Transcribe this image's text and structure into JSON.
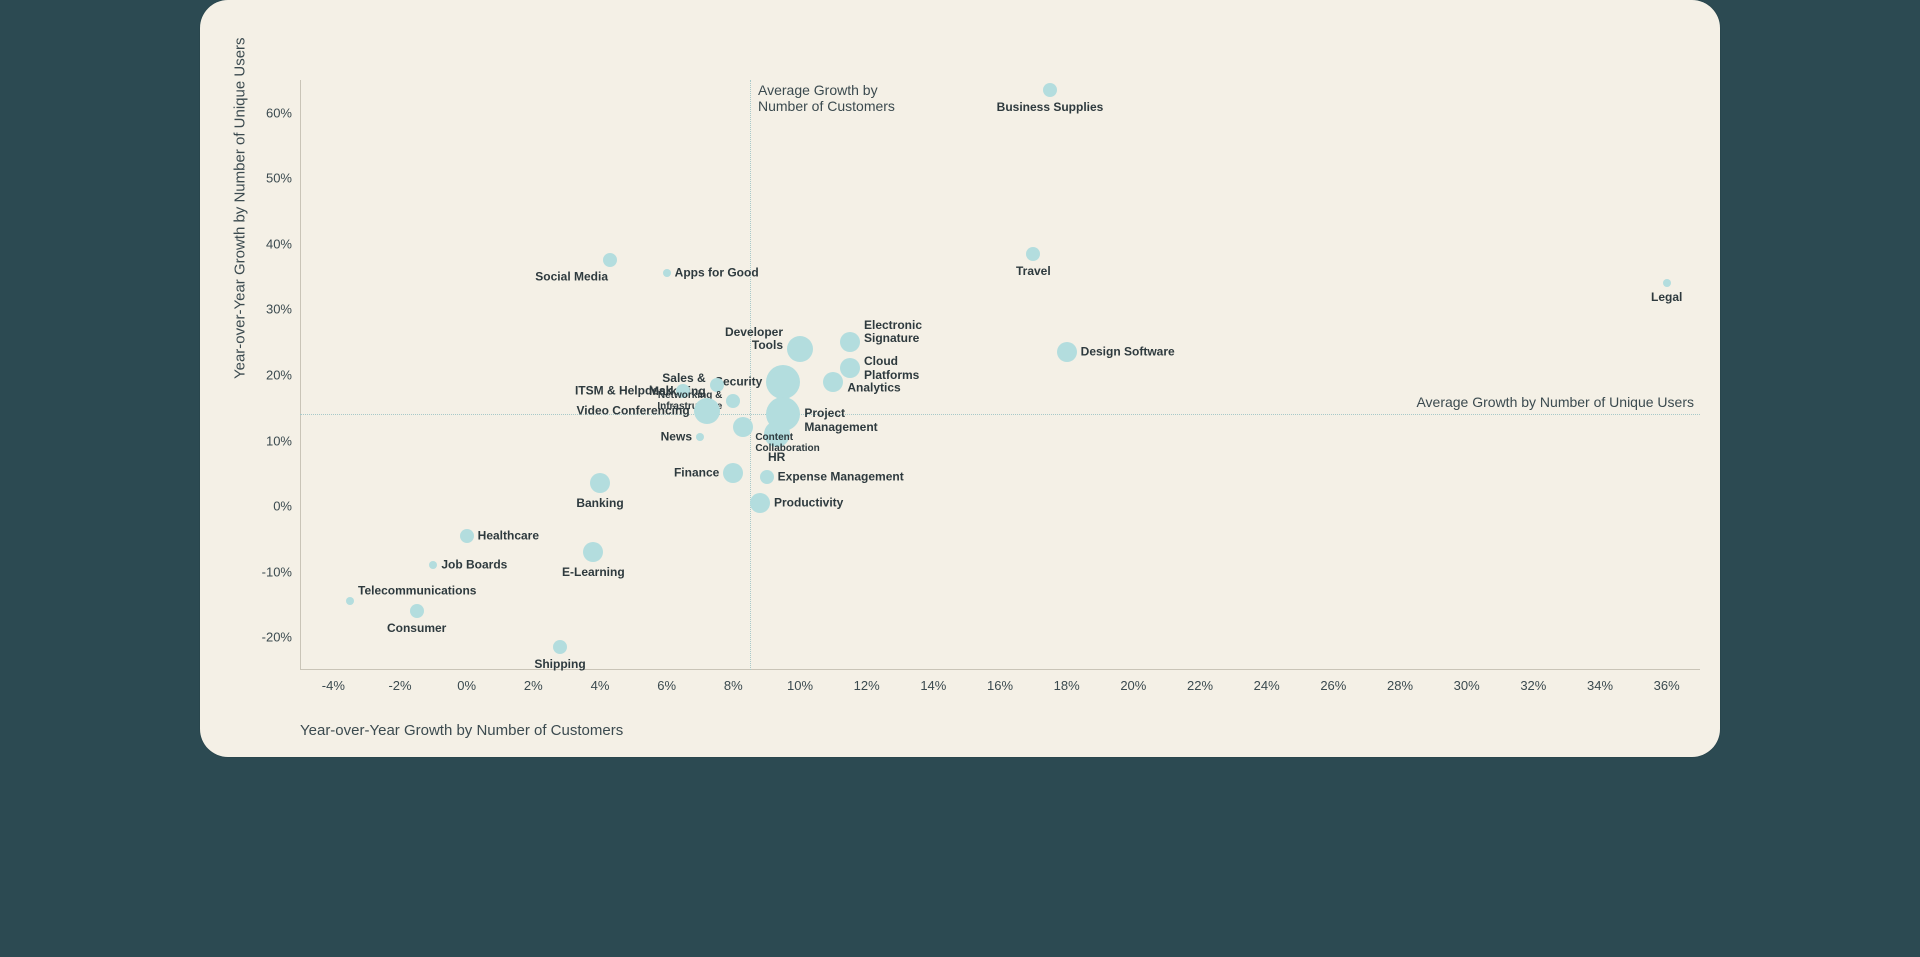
{
  "chart_data": {
    "type": "scatter",
    "title": "",
    "xlabel": "Year-over-Year Growth by Number of Customers",
    "ylabel": "Year-over-Year Growth by Number of Unique Users",
    "xlim": [
      -5,
      37
    ],
    "ylim": [
      -25,
      65
    ],
    "xticks": [
      -4,
      -2,
      0,
      2,
      4,
      6,
      8,
      10,
      12,
      14,
      16,
      18,
      20,
      22,
      24,
      26,
      28,
      30,
      32,
      34,
      36
    ],
    "yticks": [
      -20,
      -10,
      0,
      10,
      20,
      30,
      40,
      50,
      60
    ],
    "reference_lines": {
      "vertical": {
        "x": 8.5,
        "label": "Average Growth by\nNumber of Customers"
      },
      "horizontal": {
        "y": 14,
        "label": "Average Growth by Number of Unique Users"
      }
    },
    "series": [
      {
        "name": "Business Supplies",
        "x": 17.5,
        "y": 63.5,
        "size": 2,
        "label_pos": "below"
      },
      {
        "name": "Travel",
        "x": 17.0,
        "y": 38.5,
        "size": 2,
        "label_pos": "below"
      },
      {
        "name": "Social Media",
        "x": 4.3,
        "y": 37.5,
        "size": 2,
        "label_pos": "below-left"
      },
      {
        "name": "Apps for Good",
        "x": 6.0,
        "y": 35.5,
        "size": 1,
        "label_pos": "right"
      },
      {
        "name": "Legal",
        "x": 36.0,
        "y": 34.0,
        "size": 1,
        "label_pos": "below"
      },
      {
        "name": "Electronic Signature",
        "x": 11.5,
        "y": 25.0,
        "size": 3,
        "label_pos": "above-right",
        "label": "Electronic\nSignature"
      },
      {
        "name": "Developer Tools",
        "x": 10.0,
        "y": 24.0,
        "size": 4,
        "label_pos": "above-left",
        "label": "Developer\nTools"
      },
      {
        "name": "Design Software",
        "x": 18.0,
        "y": 23.5,
        "size": 3,
        "label_pos": "right"
      },
      {
        "name": "Cloud Platforms",
        "x": 11.5,
        "y": 21.0,
        "size": 3,
        "label_pos": "right",
        "label": "Cloud\nPlatforms"
      },
      {
        "name": "Security",
        "x": 9.5,
        "y": 19.0,
        "size": 5,
        "label_pos": "left"
      },
      {
        "name": "Analytics",
        "x": 11.0,
        "y": 19.0,
        "size": 3,
        "label_pos": "right-below"
      },
      {
        "name": "Sales & Marketing",
        "x": 7.5,
        "y": 18.5,
        "size": 2,
        "label_pos": "left",
        "label": "Sales &\nMarketing"
      },
      {
        "name": "ITSM & Helpdesk",
        "x": 6.5,
        "y": 17.5,
        "size": 2,
        "label_pos": "left"
      },
      {
        "name": "Networking & Infrastructure",
        "x": 8.0,
        "y": 16.0,
        "size": 2,
        "label_pos": "left",
        "label": "Networking &\nInfrastructure",
        "small": true
      },
      {
        "name": "Video Conferencing",
        "x": 7.2,
        "y": 14.5,
        "size": 4,
        "label_pos": "left"
      },
      {
        "name": "Project Management",
        "x": 9.5,
        "y": 14.0,
        "size": 5,
        "label_pos": "right-below",
        "label": "Project\nManagement"
      },
      {
        "name": "HR",
        "x": 9.3,
        "y": 11.0,
        "size": 4,
        "label_pos": "below"
      },
      {
        "name": "News",
        "x": 7.0,
        "y": 10.5,
        "size": 1,
        "label_pos": "left"
      },
      {
        "name": "Content Collaboration",
        "x": 8.3,
        "y": 12.0,
        "size": 3,
        "label_pos": "below-right",
        "label": "Content\nCollaboration",
        "small": true
      },
      {
        "name": "Finance",
        "x": 8.0,
        "y": 5.0,
        "size": 3,
        "label_pos": "left"
      },
      {
        "name": "Expense Management",
        "x": 9.0,
        "y": 4.5,
        "size": 2,
        "label_pos": "right"
      },
      {
        "name": "Banking",
        "x": 4.0,
        "y": 3.5,
        "size": 3,
        "label_pos": "below"
      },
      {
        "name": "Productivity",
        "x": 8.8,
        "y": 0.5,
        "size": 3,
        "label_pos": "right"
      },
      {
        "name": "Healthcare",
        "x": 0.0,
        "y": -4.5,
        "size": 2,
        "label_pos": "right"
      },
      {
        "name": "E-Learning",
        "x": 3.8,
        "y": -7.0,
        "size": 3,
        "label_pos": "below"
      },
      {
        "name": "Job Boards",
        "x": -1.0,
        "y": -9.0,
        "size": 1,
        "label_pos": "right"
      },
      {
        "name": "Telecommunications",
        "x": -3.5,
        "y": -14.5,
        "size": 1,
        "label_pos": "above-right"
      },
      {
        "name": "Consumer",
        "x": -1.5,
        "y": -16.0,
        "size": 2,
        "label_pos": "below"
      },
      {
        "name": "Shipping",
        "x": 2.8,
        "y": -21.5,
        "size": 2,
        "label_pos": "below"
      }
    ]
  }
}
